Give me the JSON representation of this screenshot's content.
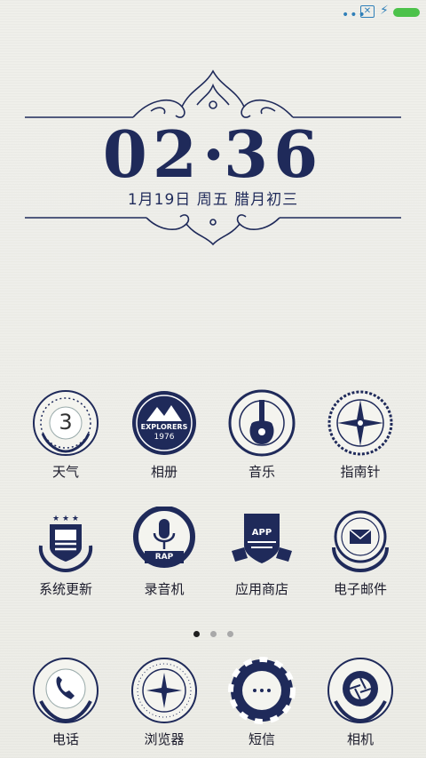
{
  "status_bar": {
    "signal_dots": "•••",
    "battery_color": "#4cc24a",
    "icon_color": "#2f7fb8",
    "icons": [
      "more-dots-icon",
      "no-sim-icon",
      "charging-icon",
      "battery-icon"
    ]
  },
  "clock": {
    "hours": "02",
    "minutes": "36",
    "date_line": "1月19日 周五 腊月初三"
  },
  "apps_page": [
    {
      "label": "天气",
      "icon": "weather-icon",
      "badge": "3"
    },
    {
      "label": "相册",
      "icon": "gallery-icon",
      "emblem_text": "EXPLORERS",
      "emblem_year": "1976"
    },
    {
      "label": "音乐",
      "icon": "music-icon"
    },
    {
      "label": "指南针",
      "icon": "compass-icon"
    },
    {
      "label": "系统更新",
      "icon": "system-update-icon"
    },
    {
      "label": "录音机",
      "icon": "recorder-icon",
      "emblem_text": "RAP"
    },
    {
      "label": "应用商店",
      "icon": "app-store-icon",
      "emblem_text": "APP"
    },
    {
      "label": "电子邮件",
      "icon": "email-icon"
    }
  ],
  "pager": {
    "count": 3,
    "active": 0
  },
  "dock": [
    {
      "label": "电话",
      "icon": "phone-icon"
    },
    {
      "label": "浏览器",
      "icon": "browser-icon"
    },
    {
      "label": "短信",
      "icon": "messages-icon"
    },
    {
      "label": "相机",
      "icon": "camera-icon"
    }
  ],
  "theme": {
    "ink": "#1f2a5a",
    "background": "#eeeee9"
  }
}
